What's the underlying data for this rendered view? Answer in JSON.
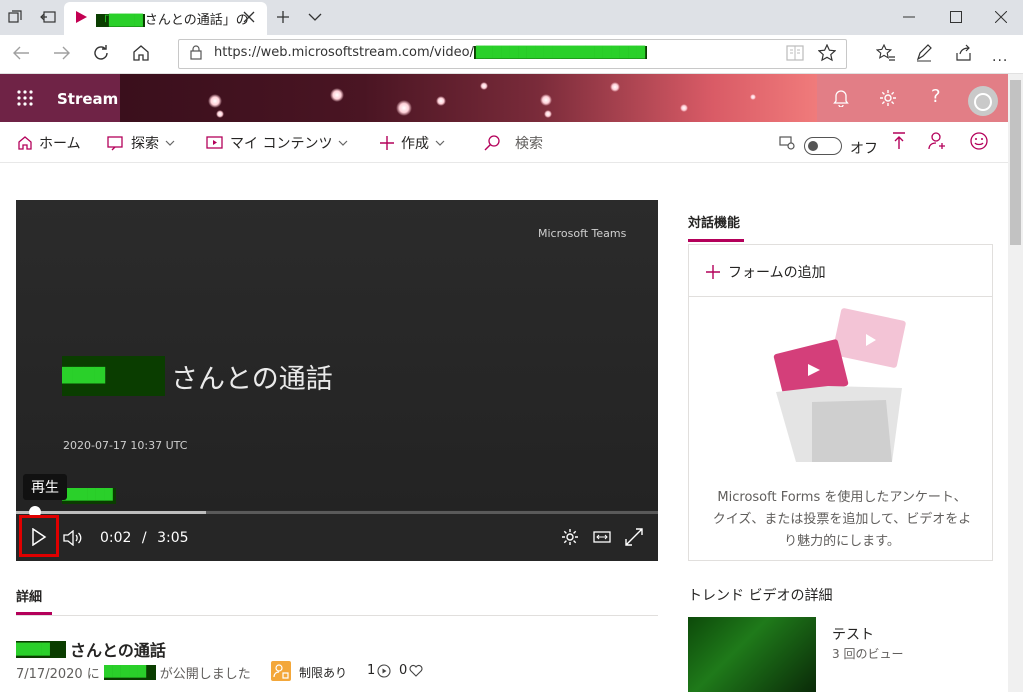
{
  "browser": {
    "tab_title": "さんとの通話」の",
    "tab_title_redacted": "「████",
    "url_prefix": "https://web.microsoftstream.com/video/",
    "url_redacted": "████████████████████"
  },
  "stream": {
    "brand": "Stream"
  },
  "nav": {
    "home": "ホーム",
    "explore": "探索",
    "my_content": "マイ コンテンツ",
    "create": "作成",
    "search": "検索",
    "toggle_label": "オフ"
  },
  "video": {
    "watermark": "Microsoft Teams",
    "title_redacted": "████",
    "title": "さんとの通話",
    "timestamp": "2020-07-17 10:37 UTC",
    "small_redacted": "██████",
    "tooltip": "再生",
    "current_time": "0:02",
    "separator": "/",
    "duration": "3:05",
    "progress": 0.29
  },
  "details": {
    "tab_label": "詳細",
    "title_redacted": "████",
    "title": "さんとの通話",
    "date_prefix": "7/17/2020 に",
    "publisher_redacted": "█████",
    "published_suffix": "が公開しました",
    "restriction": "制限あり",
    "views": "1",
    "likes": "0"
  },
  "interactive": {
    "tab_label": "対話機能",
    "add_form": "フォームの追加",
    "description": "Microsoft Forms を使用したアンケート、クイズ、または投票を追加して、ビデオをより魅力的にします。"
  },
  "trending": {
    "heading": "トレンド ビデオの詳細",
    "items": [
      {
        "title": "テスト",
        "views": "3 回のビュー"
      }
    ]
  },
  "colors": {
    "accent": "#b4005a",
    "header_bg": "#6f2346",
    "highlight_red": "#e00000"
  }
}
